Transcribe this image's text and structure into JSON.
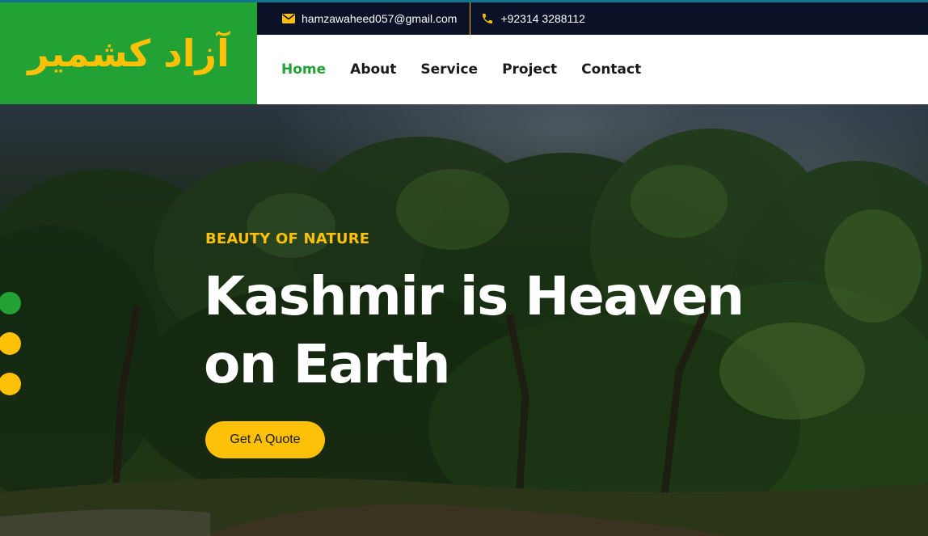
{
  "brand": {
    "logo_text": "آزاد کشمیر"
  },
  "topbar": {
    "email": "hamzawaheed057@gmail.com",
    "phone": "+92314 3288112",
    "email_icon": "envelope-icon",
    "phone_icon": "phone-icon"
  },
  "nav": {
    "items": [
      {
        "label": "Home",
        "active": true
      },
      {
        "label": "About",
        "active": false
      },
      {
        "label": "Service",
        "active": false
      },
      {
        "label": "Project",
        "active": false
      },
      {
        "label": "Contact",
        "active": false
      }
    ]
  },
  "hero": {
    "subtitle": "BEAUTY OF NATURE",
    "title_line1": "Kashmir is Heaven",
    "title_line2": "on Earth",
    "cta_label": "Get A Quote",
    "active_slide": 1
  },
  "colors": {
    "primary_green": "#22a235",
    "accent_yellow": "#ffc107",
    "dark_navy": "#0b1126"
  }
}
